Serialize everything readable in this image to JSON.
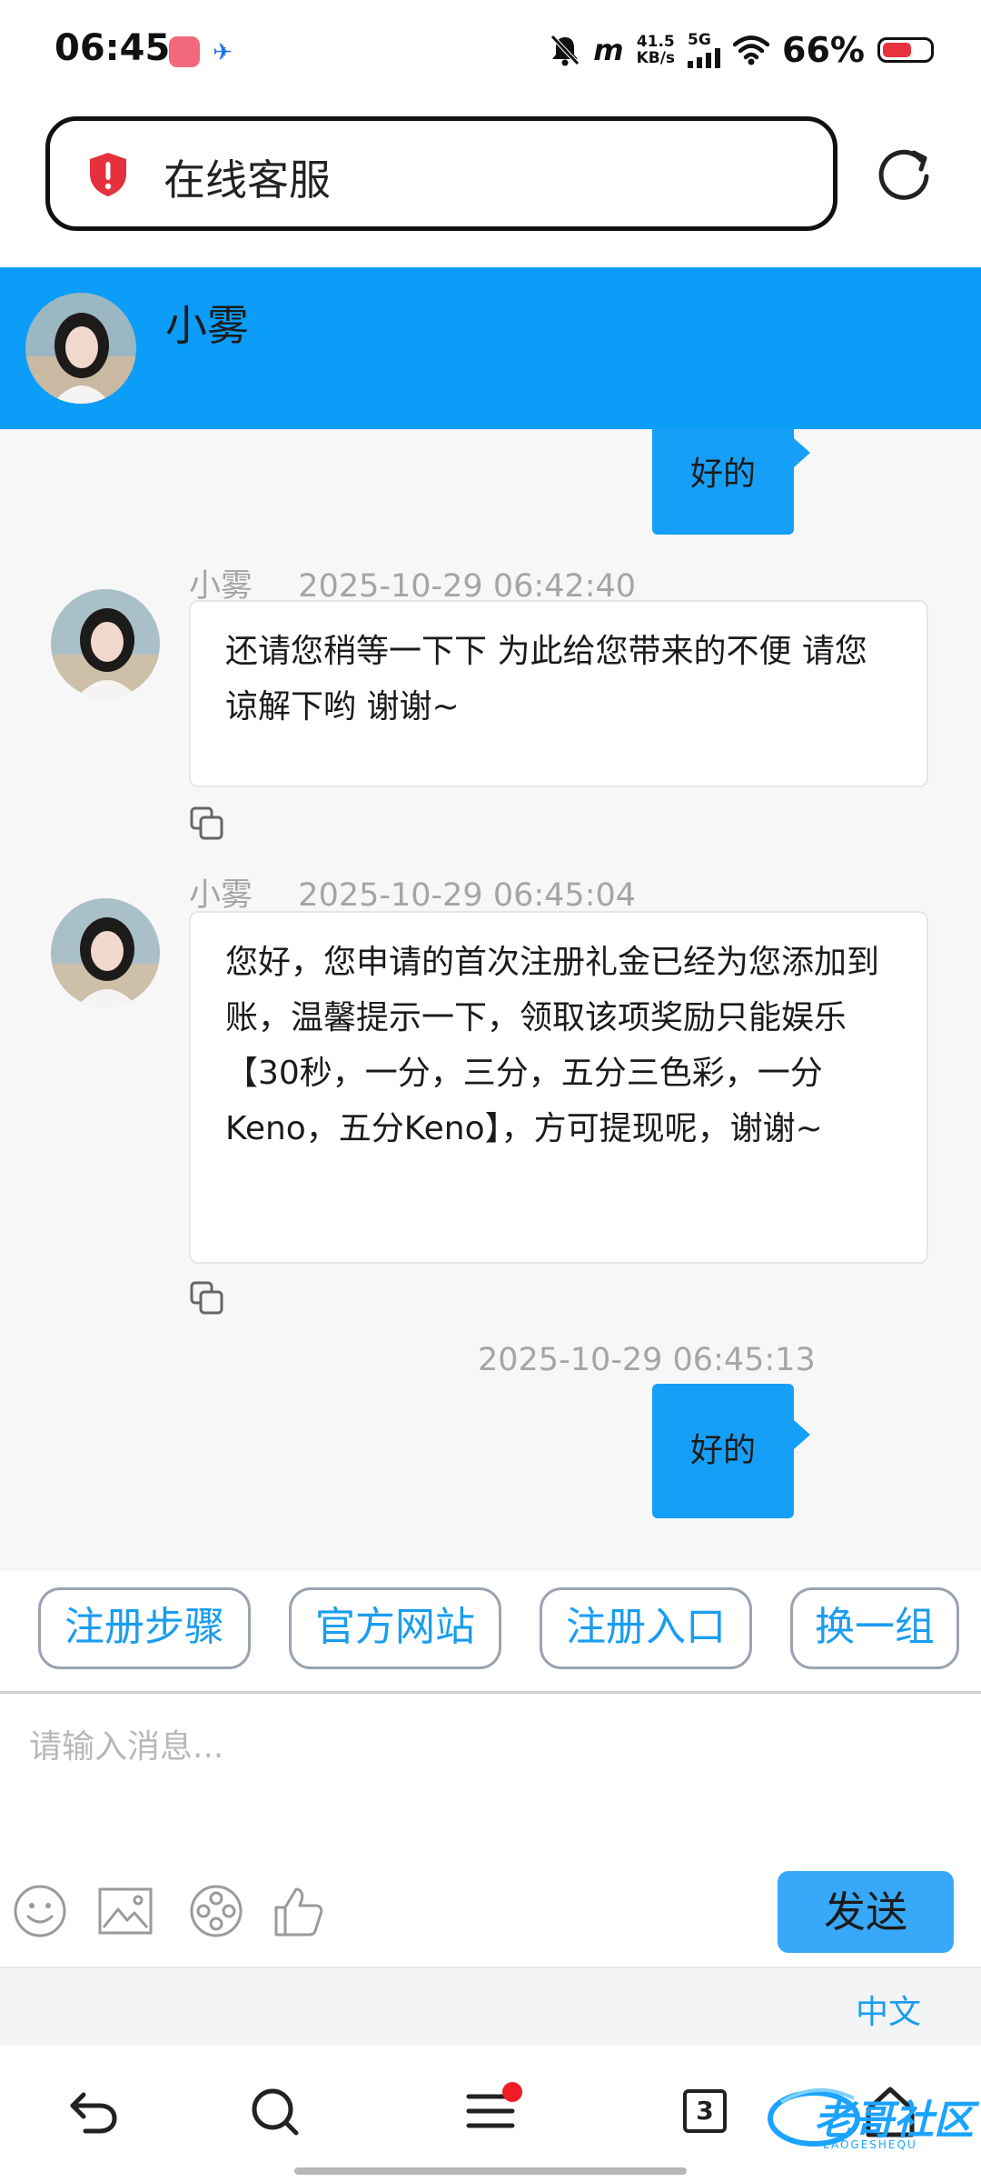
{
  "status_bar": {
    "time": "06:45",
    "net_speed": "41.5",
    "net_unit": "KB/s",
    "network": "5G",
    "battery": "66%",
    "battery_level": 0.66,
    "icons": [
      "calendar-app-icon",
      "bird-app-icon",
      "mute-icon",
      "vibrate-icon",
      "signal-icon",
      "wifi-icon",
      "battery-icon"
    ]
  },
  "url_bar": {
    "title": "在线客服",
    "security_icon": "shield-alert-icon",
    "refresh_icon": "refresh-icon"
  },
  "chat_header": {
    "agent_name": "小雾"
  },
  "messages": [
    {
      "side": "right",
      "text": "好的"
    },
    {
      "side": "left",
      "name": "小雾",
      "time": "2025-10-29 06:42:40",
      "text": "还请您稍等一下下 为此给您带来的不便 请您谅解下哟 谢谢~"
    },
    {
      "side": "left",
      "name": "小雾",
      "time": "2025-10-29 06:45:04",
      "text": "您好，您申请的首次注册礼金已经为您添加到账，温馨提示一下，领取该项奖励只能娱乐【30秒，一分，三分，五分三色彩，一分Keno，五分Keno】，方可提现呢，谢谢~"
    },
    {
      "side": "right",
      "time": "2025-10-29 06:45:13",
      "text": "好的"
    }
  ],
  "quick_replies": [
    "注册步骤",
    "官方网站",
    "注册入口",
    "换一组"
  ],
  "input": {
    "placeholder": "请输入消息...",
    "send_label": "发送",
    "tools": [
      "emoji-icon",
      "image-icon",
      "video-icon",
      "thumbs-up-icon"
    ]
  },
  "language": "中文",
  "bottom_nav": {
    "items": [
      "back-icon",
      "search-icon",
      "menu-icon",
      "tabs-icon",
      "home-icon"
    ],
    "tab_count": "3"
  },
  "watermark": {
    "text": "老哥社区",
    "sub": "LAOGESHEQU"
  },
  "colors": {
    "header_blue": "#0b9df7",
    "bubble_blue": "#169ff7",
    "send_blue": "#38a8f8",
    "link_blue": "#199df0"
  }
}
